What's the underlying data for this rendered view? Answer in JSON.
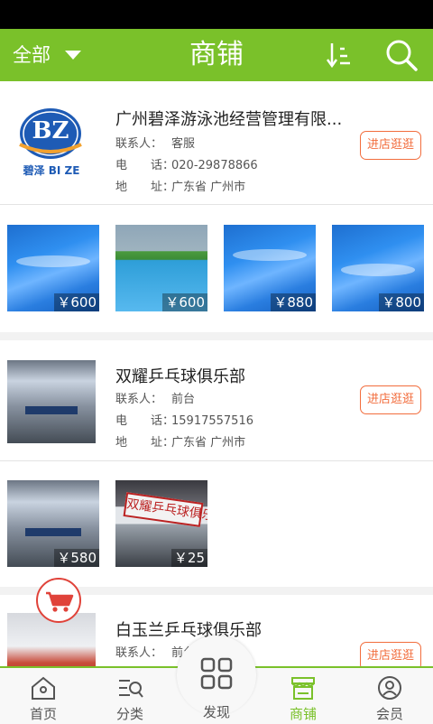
{
  "header": {
    "filter_label": "全部",
    "title": "商铺",
    "accent": "#7ac12a"
  },
  "shops": [
    {
      "name": "广州碧泽游泳池经营管理有限...",
      "logo_text": "BZ",
      "logo_sub": "碧泽 BI ZE",
      "contact_label": "联系人：",
      "contact": "客服",
      "phone_label": "电　　话：",
      "phone": "020-29878866",
      "address_label": "地　　址：",
      "address": "广东省 广州市",
      "visit_label": "进店逛逛",
      "products": [
        {
          "price": "￥600"
        },
        {
          "price": "￥600"
        },
        {
          "price": "￥880"
        },
        {
          "price": "￥800"
        }
      ]
    },
    {
      "name": "双耀乒乓球俱乐部",
      "contact_label": "联系人：",
      "contact": "前台",
      "phone_label": "电　　话：",
      "phone": "15917557516",
      "address_label": "地　　址：",
      "address": "广东省 广州市",
      "visit_label": "进店逛逛",
      "sign_text": "双耀乒乓球俱乐部",
      "products": [
        {
          "price": "￥580"
        },
        {
          "price": "￥25"
        }
      ]
    },
    {
      "name": "白玉兰乒乓球俱乐部",
      "contact_label": "联系人：",
      "contact": "前台",
      "visit_label": "进店逛逛"
    }
  ],
  "tabs": [
    {
      "label": "首页",
      "icon": "home-icon"
    },
    {
      "label": "分类",
      "icon": "category-icon"
    },
    {
      "label": "发现",
      "icon": "discover-icon"
    },
    {
      "label": "商铺",
      "icon": "store-icon",
      "active": true
    },
    {
      "label": "会员",
      "icon": "member-icon"
    }
  ]
}
